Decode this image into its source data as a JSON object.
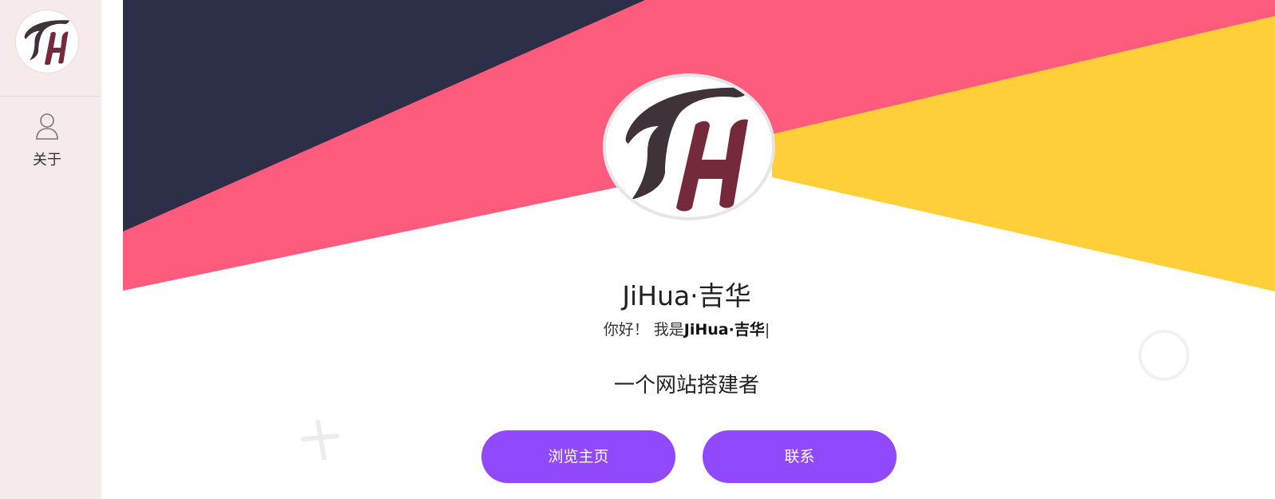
{
  "sidebar": {
    "logo_icon": "jh-logo-icon",
    "nav": [
      {
        "label": "关于",
        "icon": "user-icon"
      }
    ]
  },
  "hero": {
    "colors": {
      "navy": "#2d2e48",
      "pink": "#ff5b7c",
      "yellow": "#ffcf3a"
    },
    "avatar_icon": "jh-logo-icon",
    "name": "JiHua·吉华",
    "greeting_prefix": "你好！ 我是",
    "greeting_name": "JiHua·吉华",
    "greeting_cursor": "|",
    "tagline": "一个网站搭建者"
  },
  "buttons": {
    "home_label": "浏览主页",
    "contact_label": "联系",
    "color": "#9149fd"
  }
}
